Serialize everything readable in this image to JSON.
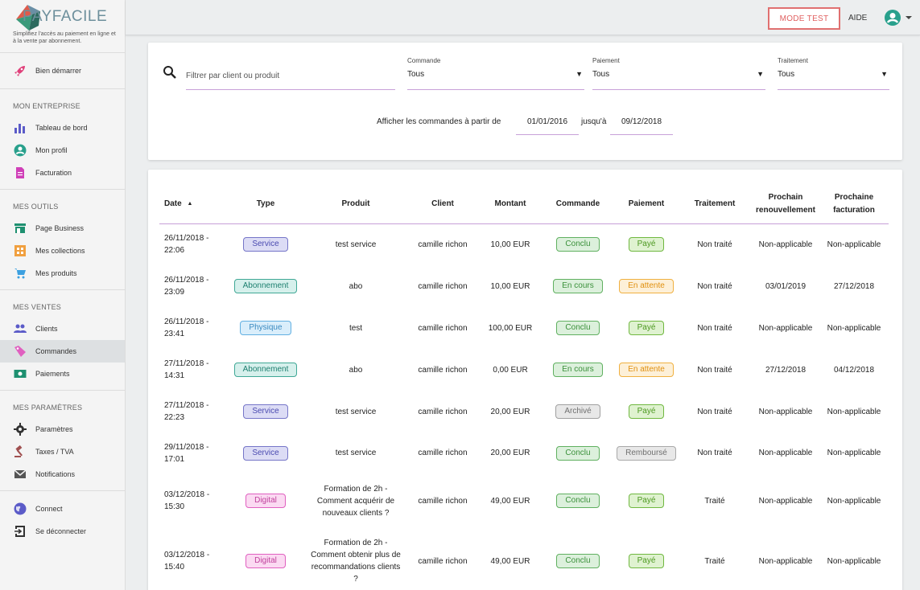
{
  "brand": {
    "name": "PAYFACILE",
    "tagline": "Simplifiez l'accès au paiement en ligne et à la vente par abonnement."
  },
  "sidebar": {
    "start": {
      "label": "Bien démarrer",
      "icon": "rocket-icon"
    },
    "sections": [
      {
        "title": "MON ENTREPRISE",
        "items": [
          {
            "label": "Tableau de bord",
            "icon": "bar-chart-icon"
          },
          {
            "label": "Mon profil",
            "icon": "account-circle-icon"
          },
          {
            "label": "Facturation",
            "icon": "document-icon"
          }
        ]
      },
      {
        "title": "MES OUTILS",
        "items": [
          {
            "label": "Page Business",
            "icon": "storefront-icon"
          },
          {
            "label": "Mes collections",
            "icon": "collections-icon"
          },
          {
            "label": "Mes produits",
            "icon": "cart-icon"
          }
        ]
      },
      {
        "title": "MES VENTES",
        "items": [
          {
            "label": "Clients",
            "icon": "people-icon"
          },
          {
            "label": "Commandes",
            "icon": "tag-icon"
          },
          {
            "label": "Paiements",
            "icon": "money-icon"
          }
        ]
      },
      {
        "title": "MES PARAMÈTRES",
        "items": [
          {
            "label": "Paramètres",
            "icon": "gear-icon"
          },
          {
            "label": "Taxes / TVA",
            "icon": "gavel-icon"
          },
          {
            "label": "Notifications",
            "icon": "mail-icon"
          }
        ]
      }
    ],
    "footer": [
      {
        "label": "Connect",
        "icon": "globe-icon"
      },
      {
        "label": "Se déconnecter",
        "icon": "logout-icon"
      }
    ]
  },
  "topbar": {
    "mode_test": "MODE TEST",
    "aide": "AIDE"
  },
  "filters": {
    "search_placeholder": "Filtrer par client ou produit",
    "commande": {
      "label": "Commande",
      "value": "Tous"
    },
    "paiement": {
      "label": "Paiement",
      "value": "Tous"
    },
    "traitement": {
      "label": "Traitement",
      "value": "Tous"
    },
    "date_prefix": "Afficher les commandes à partir de",
    "date_from": "01/01/2016",
    "date_mid": "jusqu'à",
    "date_to": "09/12/2018"
  },
  "table": {
    "headers": [
      "Date",
      "Type",
      "Produit",
      "Client",
      "Montant",
      "Commande",
      "Paiement",
      "Traitement",
      "Prochain renouvellement",
      "Prochaine facturation"
    ],
    "sort_indicator": "▲",
    "rows": [
      {
        "date": "26/11/2018 - 22:06",
        "type": "Service",
        "type_class": "service",
        "produit": "test service",
        "client": "camille richon",
        "montant": "10,00 EUR",
        "commande": "Conclu",
        "commande_class": "conclu",
        "paiement": "Payé",
        "paiement_class": "paye",
        "traitement": "Non traité",
        "renouvellement": "Non-applicable",
        "facturation": "Non-applicable"
      },
      {
        "date": "26/11/2018 - 23:09",
        "type": "Abonnement",
        "type_class": "abonnement",
        "produit": "abo",
        "client": "camille richon",
        "montant": "10,00 EUR",
        "commande": "En cours",
        "commande_class": "encours",
        "paiement": "En attente",
        "paiement_class": "attente",
        "traitement": "Non traité",
        "renouvellement": "03/01/2019",
        "facturation": "27/12/2018"
      },
      {
        "date": "26/11/2018 - 23:41",
        "type": "Physique",
        "type_class": "physique",
        "produit": "test",
        "client": "camille richon",
        "montant": "100,00 EUR",
        "commande": "Conclu",
        "commande_class": "conclu",
        "paiement": "Payé",
        "paiement_class": "paye",
        "traitement": "Non traité",
        "renouvellement": "Non-applicable",
        "facturation": "Non-applicable"
      },
      {
        "date": "27/11/2018 - 14:31",
        "type": "Abonnement",
        "type_class": "abonnement",
        "produit": "abo",
        "client": "camille richon",
        "montant": "0,00 EUR",
        "commande": "En cours",
        "commande_class": "encours",
        "paiement": "En attente",
        "paiement_class": "attente",
        "traitement": "Non traité",
        "renouvellement": "27/12/2018",
        "facturation": "04/12/2018"
      },
      {
        "date": "27/11/2018 - 22:23",
        "type": "Service",
        "type_class": "service",
        "produit": "test service",
        "client": "camille richon",
        "montant": "20,00 EUR",
        "commande": "Archivé",
        "commande_class": "archive",
        "paiement": "Payé",
        "paiement_class": "paye",
        "traitement": "Non traité",
        "renouvellement": "Non-applicable",
        "facturation": "Non-applicable"
      },
      {
        "date": "29/11/2018 - 17:01",
        "type": "Service",
        "type_class": "service",
        "produit": "test service",
        "client": "camille richon",
        "montant": "20,00 EUR",
        "commande": "Conclu",
        "commande_class": "conclu",
        "paiement": "Remboursé",
        "paiement_class": "rembourse",
        "traitement": "Non traité",
        "renouvellement": "Non-applicable",
        "facturation": "Non-applicable"
      },
      {
        "date": "03/12/2018 - 15:30",
        "type": "Digital",
        "type_class": "digital",
        "produit": "Formation de 2h - Comment acquérir de nouveaux clients ?",
        "client": "camille richon",
        "montant": "49,00 EUR",
        "commande": "Conclu",
        "commande_class": "conclu",
        "paiement": "Payé",
        "paiement_class": "paye",
        "traitement": "Traité",
        "renouvellement": "Non-applicable",
        "facturation": "Non-applicable"
      },
      {
        "date": "03/12/2018 - 15:40",
        "type": "Digital",
        "type_class": "digital",
        "produit": "Formation de 2h - Comment obtenir plus de recommandations clients ?",
        "client": "camille richon",
        "montant": "49,00 EUR",
        "commande": "Conclu",
        "commande_class": "conclu",
        "paiement": "Payé",
        "paiement_class": "paye",
        "traitement": "Traité",
        "renouvellement": "Non-applicable",
        "facturation": "Non-applicable"
      }
    ]
  }
}
